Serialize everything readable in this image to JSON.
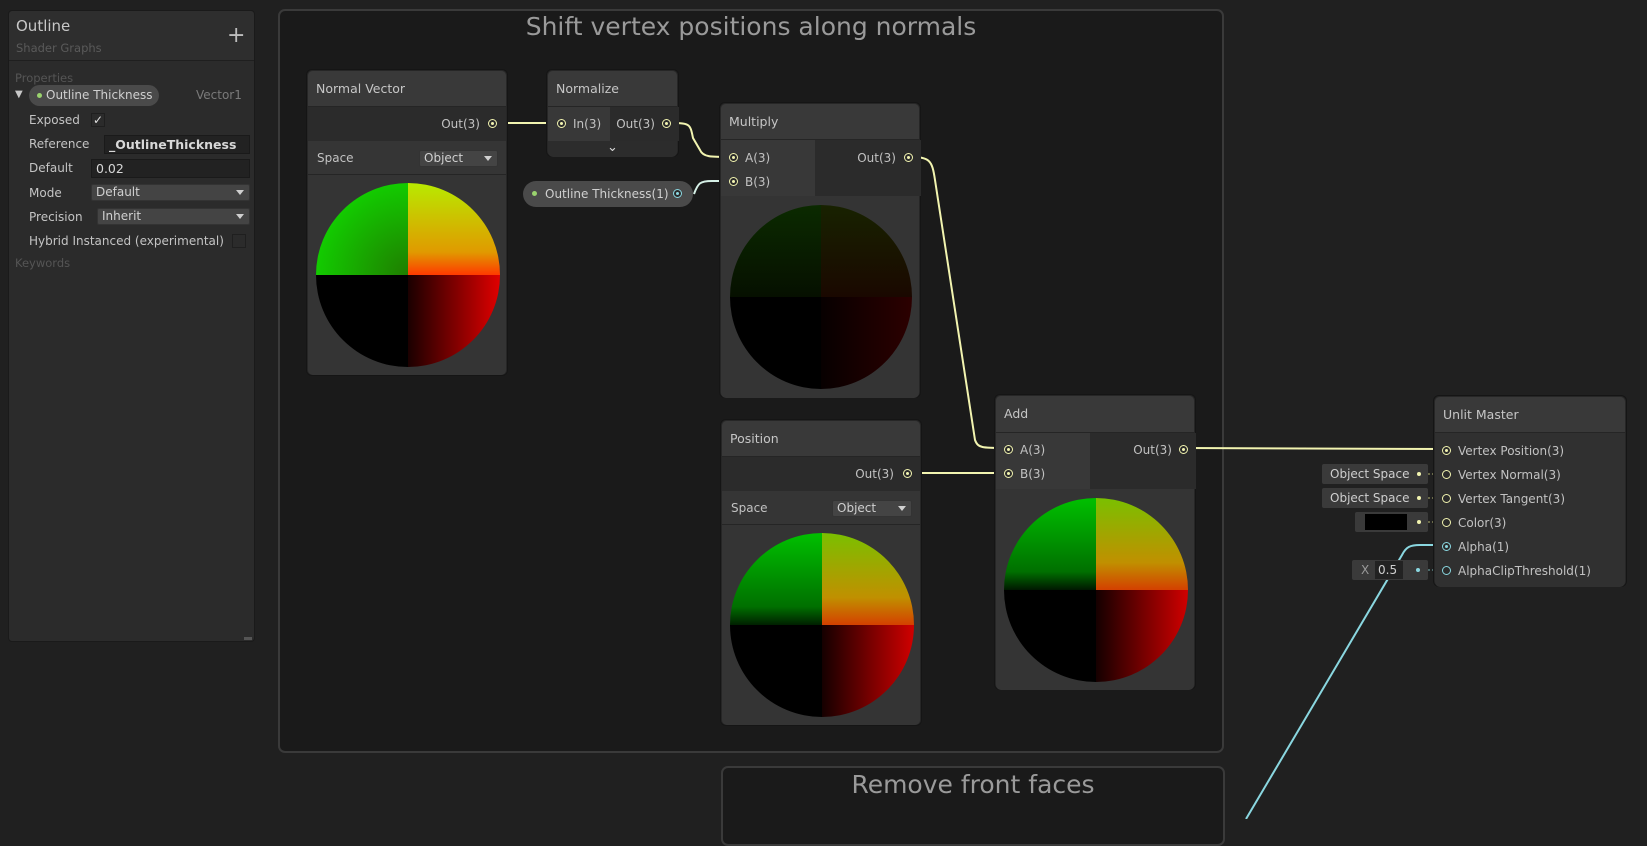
{
  "blackboard": {
    "title": "Outline",
    "subtitle": "Shader Graphs",
    "add_label": "+",
    "properties_heading": "Properties",
    "keywords_heading": "Keywords",
    "property": {
      "name": "Outline Thickness",
      "type": "Vector1",
      "exposed_label": "Exposed",
      "exposed_checked": "✓",
      "reference_label": "Reference",
      "reference_value": "_OutlineThickness",
      "default_label": "Default",
      "default_value": "0.02",
      "mode_label": "Mode",
      "mode_value": "Default",
      "precision_label": "Precision",
      "precision_value": "Inherit",
      "hybrid_label": "Hybrid Instanced (experimental)"
    }
  },
  "groups": {
    "shift": "Shift vertex positions along normals",
    "remove": "Remove front faces"
  },
  "nodes": {
    "normal_vector": {
      "title": "Normal Vector",
      "out": "Out(3)",
      "space_label": "Space",
      "space_value": "Object"
    },
    "normalize": {
      "title": "Normalize",
      "in": "In(3)",
      "out": "Out(3)",
      "expand_icon": "⌄"
    },
    "outline_prop": {
      "label": "Outline Thickness(1)"
    },
    "multiply": {
      "title": "Multiply",
      "a": "A(3)",
      "b": "B(3)",
      "out": "Out(3)"
    },
    "position": {
      "title": "Position",
      "out": "Out(3)",
      "space_label": "Space",
      "space_value": "Object"
    },
    "add": {
      "title": "Add",
      "a": "A(3)",
      "b": "B(3)",
      "out": "Out(3)"
    },
    "unlit_master": {
      "title": "Unlit Master",
      "ports": [
        "Vertex Position(3)",
        "Vertex Normal(3)",
        "Vertex Tangent(3)",
        "Color(3)",
        "Alpha(1)",
        "AlphaClipThreshold(1)"
      ],
      "normal_space": "Object Space",
      "tangent_space": "Object Space",
      "color_value": "#000000",
      "clip_axis": "X",
      "clip_value": "0.5"
    }
  },
  "colors": {
    "wire_vector3": "#f2f4b0",
    "wire_vector1": "#8ad7e0"
  }
}
